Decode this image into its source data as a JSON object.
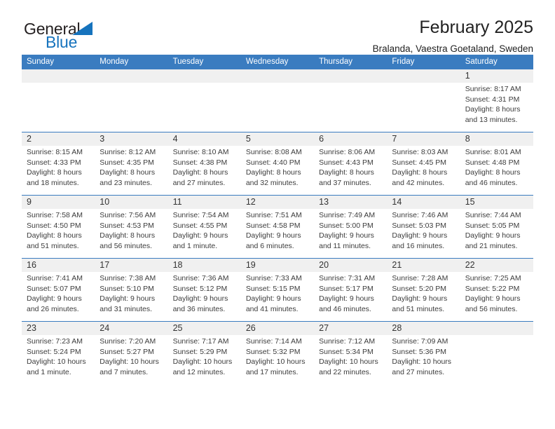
{
  "brand": {
    "name_part1": "General",
    "name_part2": "Blue",
    "triangle_color": "#1673bd",
    "text_color": "#231f20"
  },
  "header": {
    "title": "February 2025",
    "subtitle": "Bralanda, Vaestra Goetaland, Sweden"
  },
  "theme": {
    "header_blue": "#3a7cc0",
    "daynum_band": "#f0f0f0",
    "text": "#222222"
  },
  "calendar": {
    "weekday_headers": [
      "Sunday",
      "Monday",
      "Tuesday",
      "Wednesday",
      "Thursday",
      "Friday",
      "Saturday"
    ],
    "weeks": [
      [
        {
          "day": "",
          "sunrise": "",
          "sunset": "",
          "daylight_line1": "",
          "daylight_line2": ""
        },
        {
          "day": "",
          "sunrise": "",
          "sunset": "",
          "daylight_line1": "",
          "daylight_line2": ""
        },
        {
          "day": "",
          "sunrise": "",
          "sunset": "",
          "daylight_line1": "",
          "daylight_line2": ""
        },
        {
          "day": "",
          "sunrise": "",
          "sunset": "",
          "daylight_line1": "",
          "daylight_line2": ""
        },
        {
          "day": "",
          "sunrise": "",
          "sunset": "",
          "daylight_line1": "",
          "daylight_line2": ""
        },
        {
          "day": "",
          "sunrise": "",
          "sunset": "",
          "daylight_line1": "",
          "daylight_line2": ""
        },
        {
          "day": "1",
          "sunrise": "Sunrise: 8:17 AM",
          "sunset": "Sunset: 4:31 PM",
          "daylight_line1": "Daylight: 8 hours",
          "daylight_line2": "and 13 minutes."
        }
      ],
      [
        {
          "day": "2",
          "sunrise": "Sunrise: 8:15 AM",
          "sunset": "Sunset: 4:33 PM",
          "daylight_line1": "Daylight: 8 hours",
          "daylight_line2": "and 18 minutes."
        },
        {
          "day": "3",
          "sunrise": "Sunrise: 8:12 AM",
          "sunset": "Sunset: 4:35 PM",
          "daylight_line1": "Daylight: 8 hours",
          "daylight_line2": "and 23 minutes."
        },
        {
          "day": "4",
          "sunrise": "Sunrise: 8:10 AM",
          "sunset": "Sunset: 4:38 PM",
          "daylight_line1": "Daylight: 8 hours",
          "daylight_line2": "and 27 minutes."
        },
        {
          "day": "5",
          "sunrise": "Sunrise: 8:08 AM",
          "sunset": "Sunset: 4:40 PM",
          "daylight_line1": "Daylight: 8 hours",
          "daylight_line2": "and 32 minutes."
        },
        {
          "day": "6",
          "sunrise": "Sunrise: 8:06 AM",
          "sunset": "Sunset: 4:43 PM",
          "daylight_line1": "Daylight: 8 hours",
          "daylight_line2": "and 37 minutes."
        },
        {
          "day": "7",
          "sunrise": "Sunrise: 8:03 AM",
          "sunset": "Sunset: 4:45 PM",
          "daylight_line1": "Daylight: 8 hours",
          "daylight_line2": "and 42 minutes."
        },
        {
          "day": "8",
          "sunrise": "Sunrise: 8:01 AM",
          "sunset": "Sunset: 4:48 PM",
          "daylight_line1": "Daylight: 8 hours",
          "daylight_line2": "and 46 minutes."
        }
      ],
      [
        {
          "day": "9",
          "sunrise": "Sunrise: 7:58 AM",
          "sunset": "Sunset: 4:50 PM",
          "daylight_line1": "Daylight: 8 hours",
          "daylight_line2": "and 51 minutes."
        },
        {
          "day": "10",
          "sunrise": "Sunrise: 7:56 AM",
          "sunset": "Sunset: 4:53 PM",
          "daylight_line1": "Daylight: 8 hours",
          "daylight_line2": "and 56 minutes."
        },
        {
          "day": "11",
          "sunrise": "Sunrise: 7:54 AM",
          "sunset": "Sunset: 4:55 PM",
          "daylight_line1": "Daylight: 9 hours",
          "daylight_line2": "and 1 minute."
        },
        {
          "day": "12",
          "sunrise": "Sunrise: 7:51 AM",
          "sunset": "Sunset: 4:58 PM",
          "daylight_line1": "Daylight: 9 hours",
          "daylight_line2": "and 6 minutes."
        },
        {
          "day": "13",
          "sunrise": "Sunrise: 7:49 AM",
          "sunset": "Sunset: 5:00 PM",
          "daylight_line1": "Daylight: 9 hours",
          "daylight_line2": "and 11 minutes."
        },
        {
          "day": "14",
          "sunrise": "Sunrise: 7:46 AM",
          "sunset": "Sunset: 5:03 PM",
          "daylight_line1": "Daylight: 9 hours",
          "daylight_line2": "and 16 minutes."
        },
        {
          "day": "15",
          "sunrise": "Sunrise: 7:44 AM",
          "sunset": "Sunset: 5:05 PM",
          "daylight_line1": "Daylight: 9 hours",
          "daylight_line2": "and 21 minutes."
        }
      ],
      [
        {
          "day": "16",
          "sunrise": "Sunrise: 7:41 AM",
          "sunset": "Sunset: 5:07 PM",
          "daylight_line1": "Daylight: 9 hours",
          "daylight_line2": "and 26 minutes."
        },
        {
          "day": "17",
          "sunrise": "Sunrise: 7:38 AM",
          "sunset": "Sunset: 5:10 PM",
          "daylight_line1": "Daylight: 9 hours",
          "daylight_line2": "and 31 minutes."
        },
        {
          "day": "18",
          "sunrise": "Sunrise: 7:36 AM",
          "sunset": "Sunset: 5:12 PM",
          "daylight_line1": "Daylight: 9 hours",
          "daylight_line2": "and 36 minutes."
        },
        {
          "day": "19",
          "sunrise": "Sunrise: 7:33 AM",
          "sunset": "Sunset: 5:15 PM",
          "daylight_line1": "Daylight: 9 hours",
          "daylight_line2": "and 41 minutes."
        },
        {
          "day": "20",
          "sunrise": "Sunrise: 7:31 AM",
          "sunset": "Sunset: 5:17 PM",
          "daylight_line1": "Daylight: 9 hours",
          "daylight_line2": "and 46 minutes."
        },
        {
          "day": "21",
          "sunrise": "Sunrise: 7:28 AM",
          "sunset": "Sunset: 5:20 PM",
          "daylight_line1": "Daylight: 9 hours",
          "daylight_line2": "and 51 minutes."
        },
        {
          "day": "22",
          "sunrise": "Sunrise: 7:25 AM",
          "sunset": "Sunset: 5:22 PM",
          "daylight_line1": "Daylight: 9 hours",
          "daylight_line2": "and 56 minutes."
        }
      ],
      [
        {
          "day": "23",
          "sunrise": "Sunrise: 7:23 AM",
          "sunset": "Sunset: 5:24 PM",
          "daylight_line1": "Daylight: 10 hours",
          "daylight_line2": "and 1 minute."
        },
        {
          "day": "24",
          "sunrise": "Sunrise: 7:20 AM",
          "sunset": "Sunset: 5:27 PM",
          "daylight_line1": "Daylight: 10 hours",
          "daylight_line2": "and 7 minutes."
        },
        {
          "day": "25",
          "sunrise": "Sunrise: 7:17 AM",
          "sunset": "Sunset: 5:29 PM",
          "daylight_line1": "Daylight: 10 hours",
          "daylight_line2": "and 12 minutes."
        },
        {
          "day": "26",
          "sunrise": "Sunrise: 7:14 AM",
          "sunset": "Sunset: 5:32 PM",
          "daylight_line1": "Daylight: 10 hours",
          "daylight_line2": "and 17 minutes."
        },
        {
          "day": "27",
          "sunrise": "Sunrise: 7:12 AM",
          "sunset": "Sunset: 5:34 PM",
          "daylight_line1": "Daylight: 10 hours",
          "daylight_line2": "and 22 minutes."
        },
        {
          "day": "28",
          "sunrise": "Sunrise: 7:09 AM",
          "sunset": "Sunset: 5:36 PM",
          "daylight_line1": "Daylight: 10 hours",
          "daylight_line2": "and 27 minutes."
        },
        {
          "day": "",
          "sunrise": "",
          "sunset": "",
          "daylight_line1": "",
          "daylight_line2": ""
        }
      ]
    ]
  }
}
